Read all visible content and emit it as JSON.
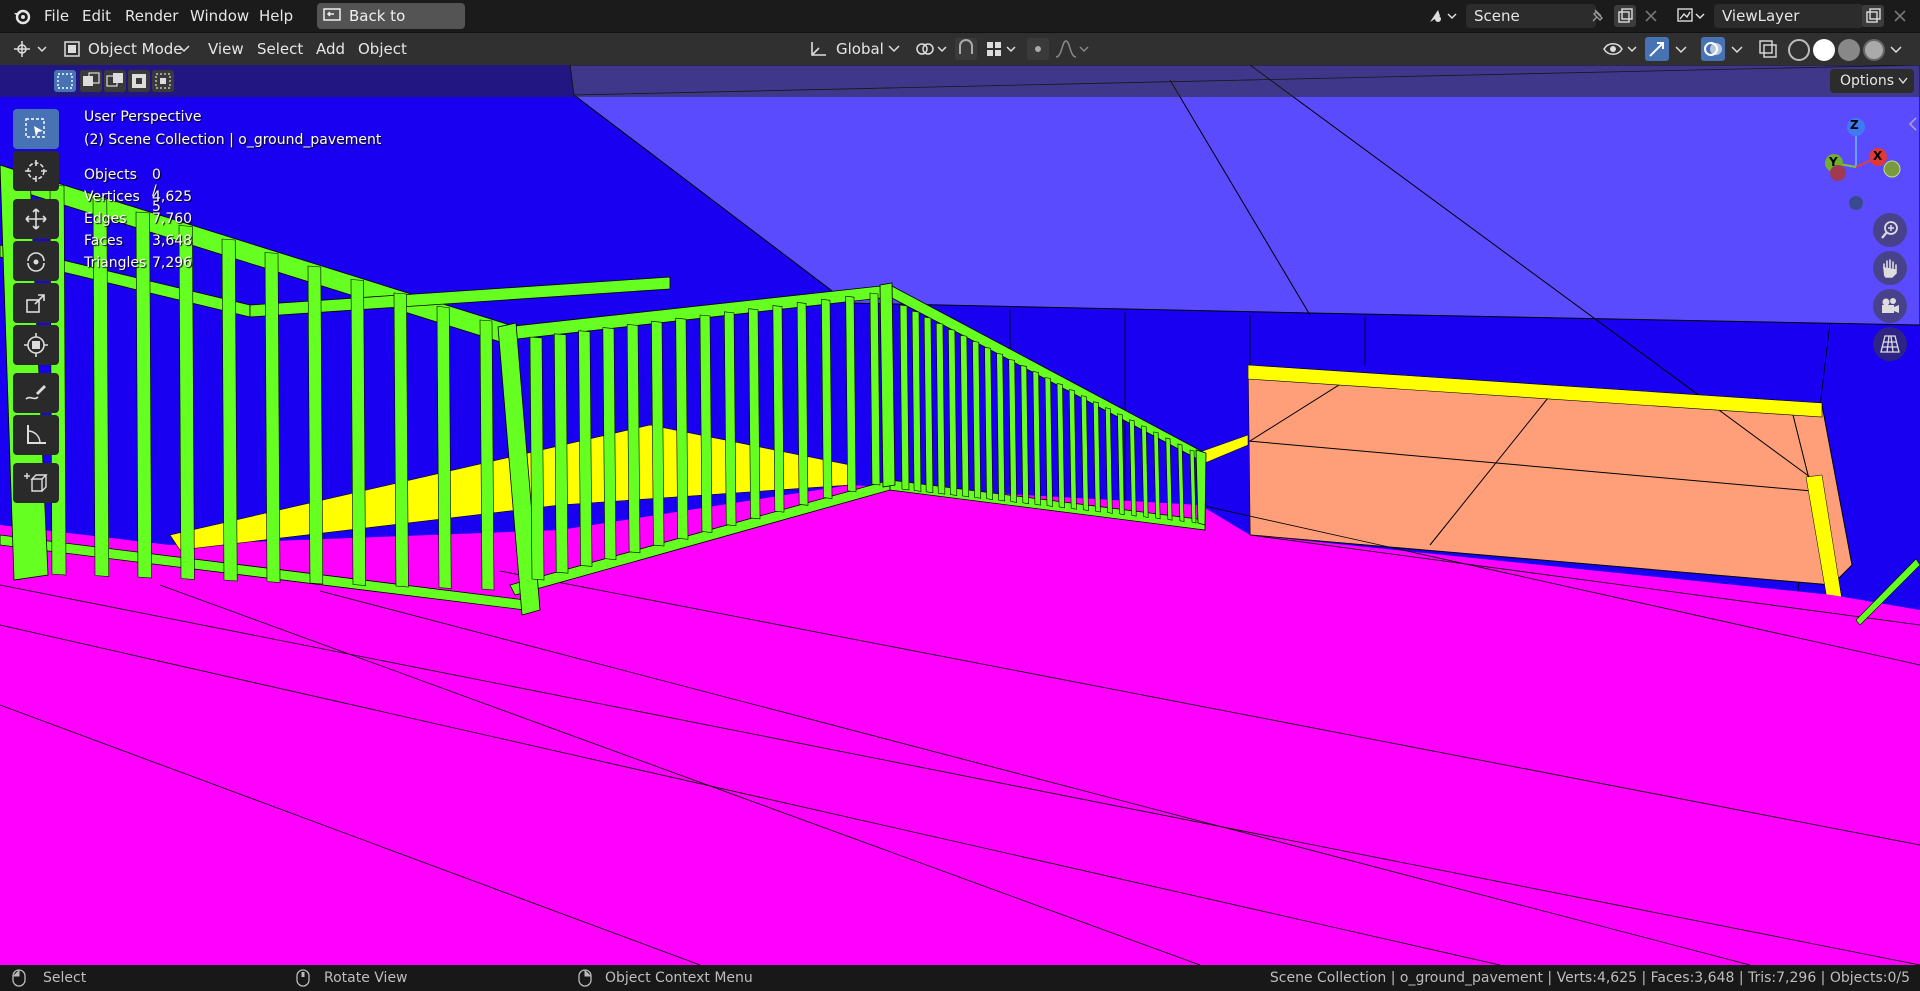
{
  "menu": {
    "file": "File",
    "edit": "Edit",
    "render": "Render",
    "window": "Window",
    "help": "Help",
    "back_button": "Back to Previous"
  },
  "scene": {
    "name": "Scene",
    "view_layer": "ViewLayer"
  },
  "header": {
    "mode": "Object Mode",
    "view": "View",
    "select": "Select",
    "add": "Add",
    "object": "Object",
    "orientation": "Global",
    "options": "Options"
  },
  "overlay": {
    "perspective": "User Perspective",
    "collection": "(2) Scene Collection | o_ground_pavement",
    "stats": [
      {
        "label": "Objects",
        "value": "0 / 5"
      },
      {
        "label": "Vertices",
        "value": "4,625"
      },
      {
        "label": "Edges",
        "value": "7,760"
      },
      {
        "label": "Faces",
        "value": "3,648"
      },
      {
        "label": "Triangles",
        "value": "7,296"
      }
    ]
  },
  "gizmo": {
    "z": "Z",
    "y": "Y",
    "x": "X"
  },
  "status": {
    "select": "Select",
    "rotate": "Rotate View",
    "context": "Object Context Menu",
    "info": "Scene Collection | o_ground_pavement | Verts:4,625 | Faces:3,648 | Tris:7,296 | Objects:0/5"
  },
  "colors": {
    "wall_blue": "#1a00f0",
    "ceiling": "#5b4bff",
    "floor_magenta": "#ff00ff",
    "railing_green": "#66ff22",
    "trim_yellow": "#ffff00",
    "tiles": "#ff9f7a",
    "accent": "#4772b3"
  }
}
